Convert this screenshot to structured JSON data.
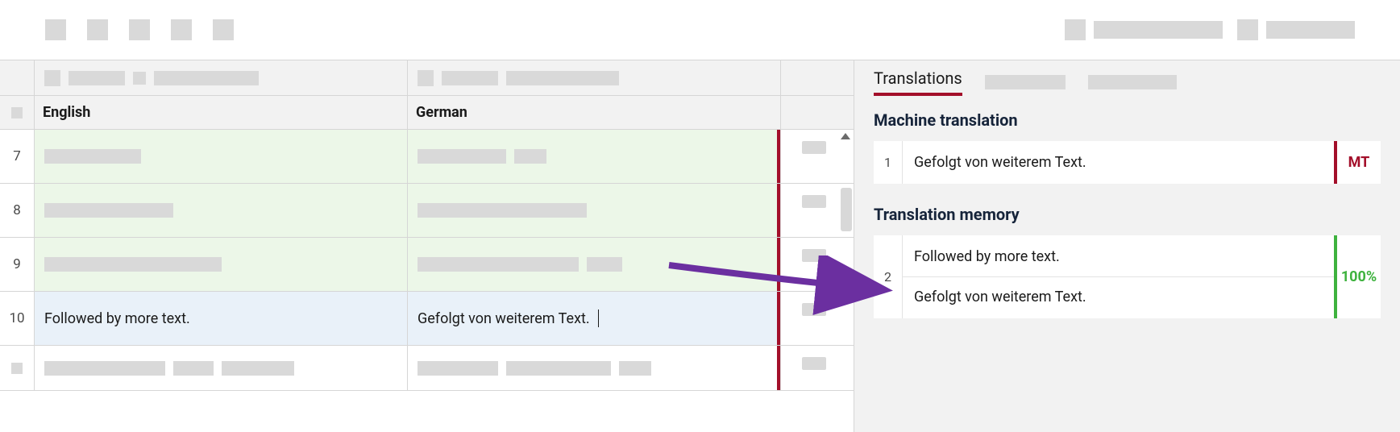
{
  "columns": {
    "source_lang": "English",
    "target_lang": "German"
  },
  "segments": [
    {
      "n": "7",
      "source": "",
      "target": "",
      "state": "green"
    },
    {
      "n": "8",
      "source": "",
      "target": "",
      "state": "green"
    },
    {
      "n": "9",
      "source": "",
      "target": "",
      "state": "green"
    },
    {
      "n": "10",
      "source": "Followed by more text.",
      "target": "Gefolgt von weiterem Text.",
      "state": "blue",
      "active": true
    }
  ],
  "sidebar": {
    "tabs": {
      "translations": "Translations"
    },
    "mt": {
      "title": "Machine translation",
      "idx": "1",
      "text": "Gefolgt von weiterem Text.",
      "badge": "MT"
    },
    "tm": {
      "title": "Translation memory",
      "idx": "2",
      "source": "Followed by more text.",
      "target": "Gefolgt von weiterem Text.",
      "match": "100%"
    }
  }
}
